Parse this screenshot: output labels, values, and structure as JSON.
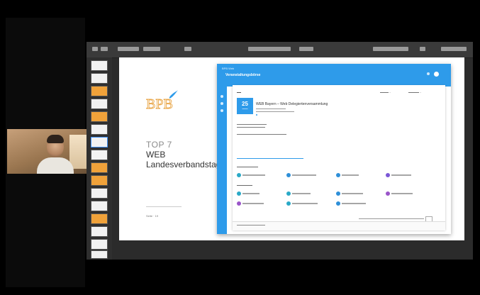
{
  "camera": {
    "participant": "video participant"
  },
  "slide": {
    "title_top": "TOP 7",
    "title_line1": "WEB",
    "title_line2": "Landesverbandstag",
    "logo_text": "BPB",
    "page_label": "Seite · 19"
  },
  "web": {
    "brand": "BPB Web",
    "heading": "Veranstaltungsbörse",
    "event": {
      "day": "25",
      "title": "WEB Bayern – Web Delegiertenversammlung"
    }
  },
  "colors": {
    "accent": "#2e9bea",
    "logo_orange": "#e9a74a",
    "slide_bg": "#ffffff",
    "app_bg": "#2b2b2b"
  },
  "icons": {
    "logo": "bpb-logo",
    "avatar": "avatar-icon",
    "menu": "menu-icon"
  }
}
